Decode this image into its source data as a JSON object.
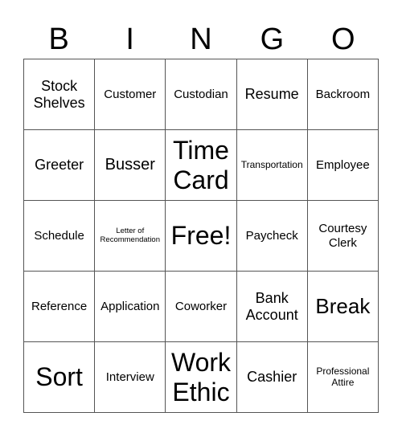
{
  "header": [
    "B",
    "I",
    "N",
    "G",
    "O"
  ],
  "cells": [
    {
      "text": "Stock Shelves",
      "size": "s-lg"
    },
    {
      "text": "Customer",
      "size": "s-md"
    },
    {
      "text": "Custodian",
      "size": "s-md"
    },
    {
      "text": "Resume",
      "size": "s-lg"
    },
    {
      "text": "Backroom",
      "size": "s-md"
    },
    {
      "text": "Greeter",
      "size": "s-lg"
    },
    {
      "text": "Busser",
      "size": "s-xl"
    },
    {
      "text": "Time Card",
      "size": "s-huge"
    },
    {
      "text": "Transportation",
      "size": "s-sm"
    },
    {
      "text": "Employee",
      "size": "s-md"
    },
    {
      "text": "Schedule",
      "size": "s-md"
    },
    {
      "text": "Letter of Recommendation",
      "size": "s-xs"
    },
    {
      "text": "Free!",
      "size": "s-huge"
    },
    {
      "text": "Paycheck",
      "size": "s-md"
    },
    {
      "text": "Courtesy Clerk",
      "size": "s-md"
    },
    {
      "text": "Reference",
      "size": "s-md"
    },
    {
      "text": "Application",
      "size": "s-md"
    },
    {
      "text": "Coworker",
      "size": "s-md"
    },
    {
      "text": "Bank Account",
      "size": "s-lg"
    },
    {
      "text": "Break",
      "size": "s-xxl"
    },
    {
      "text": "Sort",
      "size": "s-huge"
    },
    {
      "text": "Interview",
      "size": "s-md"
    },
    {
      "text": "Work Ethic",
      "size": "s-huge"
    },
    {
      "text": "Cashier",
      "size": "s-lg"
    },
    {
      "text": "Professional Attire",
      "size": "s-sm"
    }
  ]
}
